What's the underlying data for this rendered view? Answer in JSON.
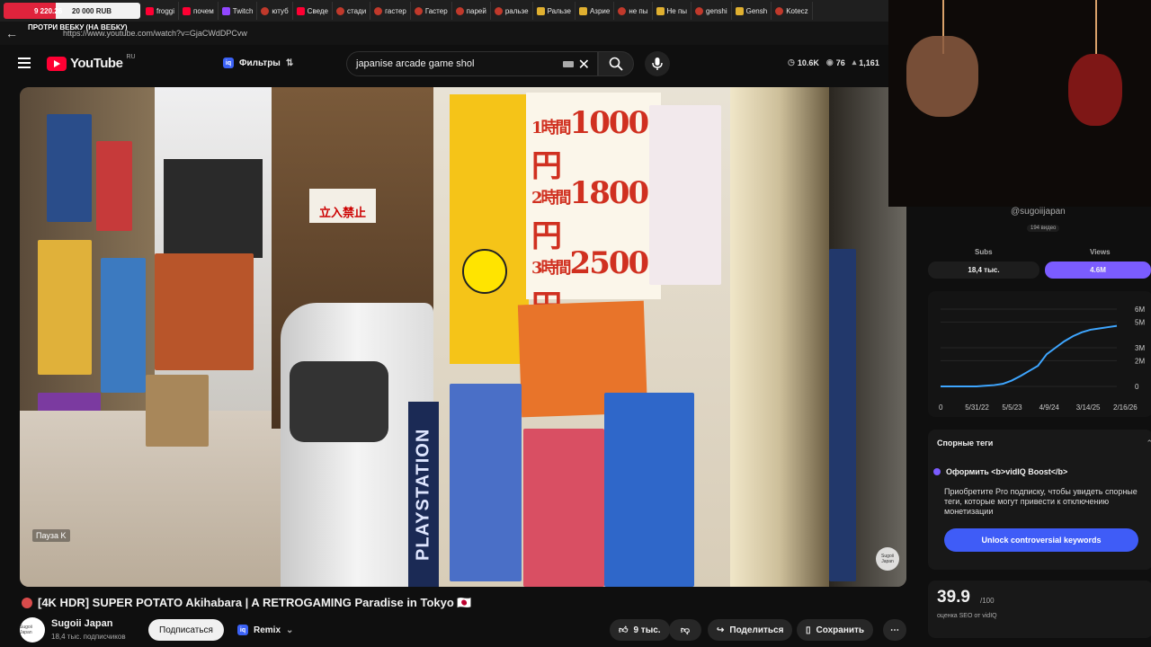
{
  "browser": {
    "donation": {
      "amount_left": "9 220.26",
      "amount_right": "20 000 RUB"
    },
    "tabs": [
      {
        "label": "froggi",
        "icon": "youtube-icon"
      },
      {
        "label": "почем",
        "icon": "youtube-icon"
      },
      {
        "label": "Twitch",
        "icon": "twitch-icon"
      },
      {
        "label": "ютуб",
        "icon": "globe-icon"
      },
      {
        "label": "Сведе",
        "icon": "youtube-icon"
      },
      {
        "label": "стади",
        "icon": "globe-icon"
      },
      {
        "label": "гастер",
        "icon": "globe-icon"
      },
      {
        "label": "Гастер",
        "icon": "globe-icon"
      },
      {
        "label": "парей",
        "icon": "globe-icon"
      },
      {
        "label": "ральзе",
        "icon": "globe-icon"
      },
      {
        "label": "Ральзе",
        "icon": "bookmark-icon"
      },
      {
        "label": "Азрие",
        "icon": "bookmark-icon"
      },
      {
        "label": "не пы",
        "icon": "globe-icon"
      },
      {
        "label": "Не пы",
        "icon": "bookmark-icon"
      },
      {
        "label": "genshi",
        "icon": "globe-icon"
      },
      {
        "label": "Gensh",
        "icon": "bookmark-icon"
      },
      {
        "label": "Kotecz",
        "icon": "globe-icon"
      }
    ],
    "url": "https://www.youtube.com/watch?v=GjaCWdDPCvw",
    "overlay_label": "ПРОТРИ ВЕБКУ (НА ВЕБКУ)"
  },
  "header": {
    "logo": "YouTube",
    "region": "RU",
    "filters_label": "Фильтры",
    "search_value": "japanise arcade game shol",
    "stats": {
      "views": "10.6K",
      "watching": "76",
      "likes": "1,161"
    }
  },
  "video": {
    "sign_text": "立入禁止",
    "prices": [
      "1000円",
      "1800円",
      "2500円"
    ],
    "price_prefixes": [
      "1時間",
      "2時間",
      "3時間"
    ],
    "station_text": "PLAYSTATION",
    "pause_hint": "Пауза  K",
    "watermark": "Sugoii Japan"
  },
  "meta": {
    "title": "[4K HDR] SUPER POTATO Akihabara | A RETROGAMING Paradise in Tokyo 🇯🇵",
    "channel_name": "Sugoii Japan",
    "channel_subs": "18,4 тыс. подписчиков",
    "subscribe_label": "Подписаться",
    "remix_label": "Remix",
    "likes_label": "9 тыс.",
    "share_label": "Поделиться",
    "save_label": "Сохранить"
  },
  "sidebar": {
    "handle": "@sugoiijapan",
    "video_count": "194 видео",
    "subs_label": "Subs",
    "subs_value": "18,4 тыс.",
    "views_label": "Views",
    "views_value": "4.6M",
    "seo_title": "Спорные теги",
    "boost_label": "Оформить <b>vidIQ Boost</b>",
    "promo_text": "Приобретите Pro подписку, чтобы увидеть спорные теги, которые могут привести к отключению монетизации",
    "unlock_label": "Unlock controversial keywords",
    "score": "39.9",
    "score_max": "/100",
    "score_label": "оценка SEO от vidIQ"
  },
  "chart_data": {
    "type": "line",
    "title": "",
    "xlabel": "",
    "ylabel": "",
    "x_ticks": [
      "0",
      "5/31/22",
      "5/5/23",
      "4/9/24",
      "3/14/25",
      "2/16/26"
    ],
    "y_ticks": [
      "0",
      "2M",
      "3M",
      "5M",
      "6M"
    ],
    "ylim": [
      0,
      6
    ],
    "series": [
      {
        "values": [
          0,
          0.05,
          0.1,
          0.2,
          0.45,
          0.8,
          1.2,
          1.6,
          2.5,
          3.0,
          3.5,
          3.9,
          4.2,
          4.4,
          4.5,
          4.6,
          4.7
        ]
      }
    ],
    "line_color": "#3ea6ff"
  }
}
